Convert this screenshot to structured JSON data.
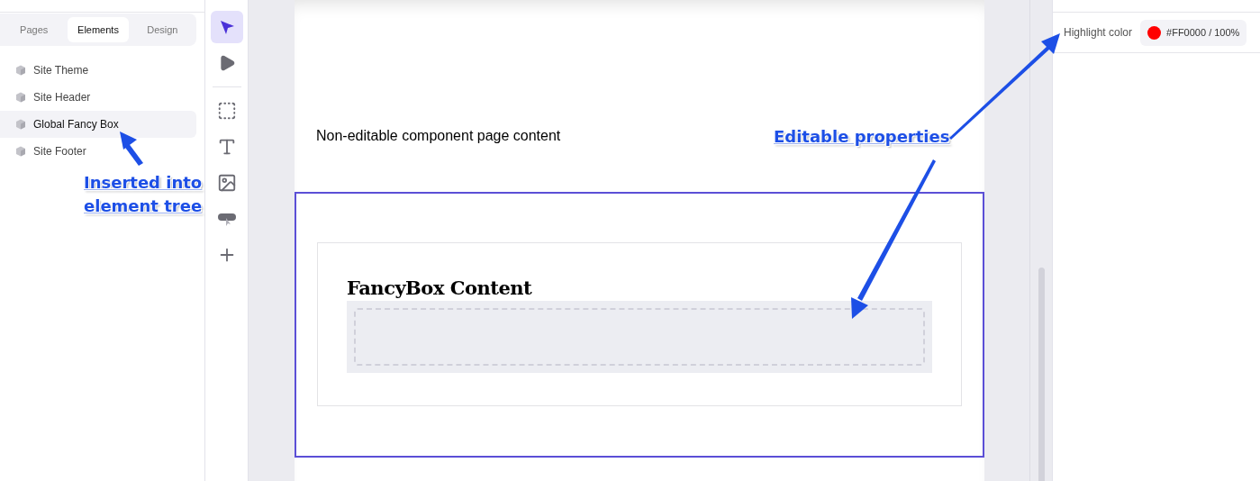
{
  "left_panel": {
    "tabs": [
      {
        "label": "Pages",
        "selected": false
      },
      {
        "label": "Elements",
        "selected": true
      },
      {
        "label": "Design",
        "selected": false
      }
    ],
    "elements": [
      {
        "label": "Site Theme",
        "selected": false
      },
      {
        "label": "Site Header",
        "selected": false
      },
      {
        "label": "Global Fancy Box",
        "selected": true
      },
      {
        "label": "Site Footer",
        "selected": false
      }
    ]
  },
  "toolbar": {
    "tools": [
      {
        "kind": "pointer",
        "selected": true
      },
      {
        "kind": "play",
        "selected": false
      },
      {
        "kind": "separator"
      },
      {
        "kind": "frame",
        "selected": false
      },
      {
        "kind": "text",
        "selected": false
      },
      {
        "kind": "image",
        "selected": false
      },
      {
        "kind": "component",
        "selected": false
      },
      {
        "kind": "add",
        "selected": false
      }
    ]
  },
  "canvas": {
    "page_text": "Non-editable component page content",
    "fancy_box": {
      "heading": "FancyBox Content"
    }
  },
  "properties": {
    "label": "Highlight color",
    "value": "#FF0000 / 100%",
    "color": "#ff0000"
  },
  "annotations": [
    {
      "kind": "tree",
      "lines": [
        "Inserted into",
        "element tree"
      ]
    },
    {
      "kind": "properties",
      "lines": [
        "Editable properties"
      ]
    }
  ]
}
